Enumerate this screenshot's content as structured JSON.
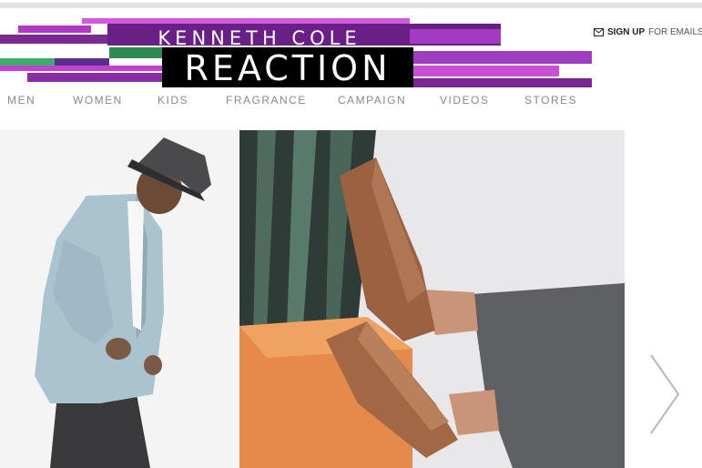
{
  "brand": {
    "line1": "KENNETH COLE",
    "line2": "REACTION"
  },
  "signup": {
    "icon": "envelope-icon",
    "strong": "SIGN UP",
    "rest": " FOR EMAILS"
  },
  "nav": {
    "items": [
      {
        "label": "MEN"
      },
      {
        "label": "WOMEN"
      },
      {
        "label": "KIDS"
      },
      {
        "label": "FRAGRANCE"
      },
      {
        "label": "CAMPAIGN"
      },
      {
        "label": "VIDEOS"
      },
      {
        "label": "STORES"
      }
    ]
  },
  "hero": {
    "next_icon": "chevron-right-icon"
  },
  "colors": {
    "logo_black": "#000000",
    "logo_purple": "#8b2ea3",
    "logo_magenta": "#c23fd1",
    "logo_green": "#3cae6a",
    "nav_text": "#8a8a8a"
  }
}
